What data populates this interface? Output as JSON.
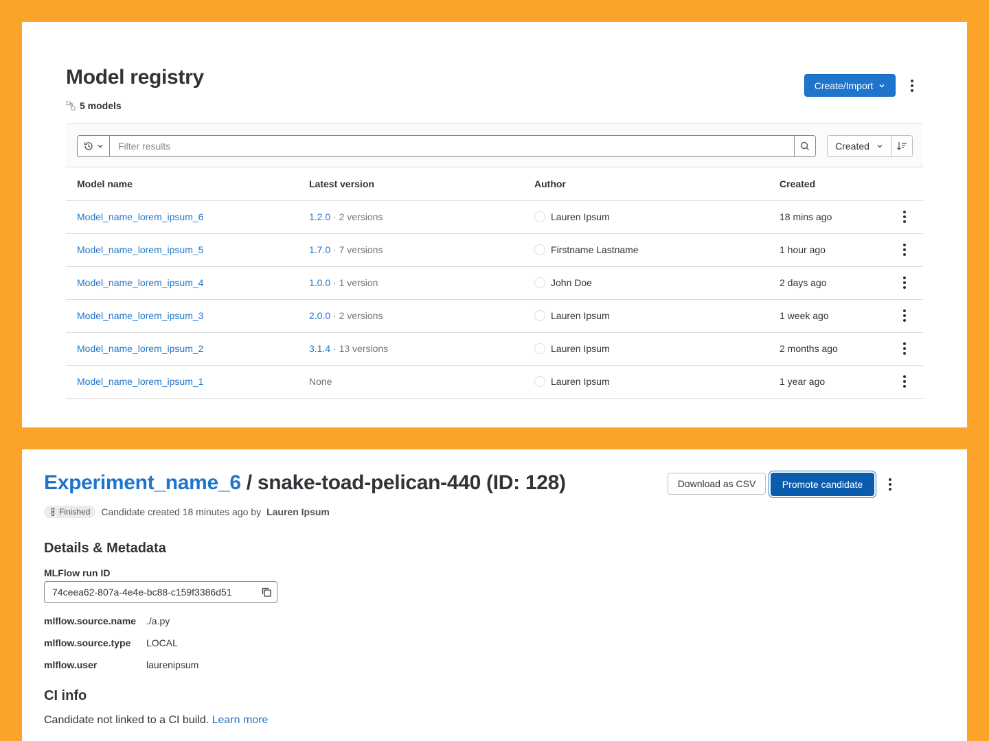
{
  "registry": {
    "title": "Model registry",
    "count_label": "5 models",
    "create_button": "Create/Import",
    "filter_placeholder": "Filter results",
    "sort_label": "Created",
    "columns": [
      "Model name",
      "Latest version",
      "Author",
      "Created"
    ],
    "rows": [
      {
        "name": "Model_name_lorem_ipsum_6",
        "version": "1.2.0",
        "versions": "· 2 versions",
        "author": "Lauren Ipsum",
        "created": "18 mins ago"
      },
      {
        "name": "Model_name_lorem_ipsum_5",
        "version": "1.7.0",
        "versions": "· 7 versions",
        "author": "Firstname Lastname",
        "created": "1 hour ago"
      },
      {
        "name": "Model_name_lorem_ipsum_4",
        "version": "1.0.0",
        "versions": "· 1 version",
        "author": "John Doe",
        "created": "2 days ago"
      },
      {
        "name": "Model_name_lorem_ipsum_3",
        "version": "2.0.0",
        "versions": "· 2 versions",
        "author": "Lauren Ipsum",
        "created": "1 week ago"
      },
      {
        "name": "Model_name_lorem_ipsum_2",
        "version": "3.1.4",
        "versions": "· 13 versions",
        "author": "Lauren Ipsum",
        "created": "2 months ago"
      },
      {
        "name": "Model_name_lorem_ipsum_1",
        "version": "",
        "versions": "None",
        "author": "Lauren Ipsum",
        "created": "1 year ago"
      }
    ]
  },
  "candidate": {
    "experiment_link": "Experiment_name_6",
    "separator": " / ",
    "candidate_name": "snake-toad-pelican-440 (ID: 128)",
    "download_button": "Download as CSV",
    "promote_button": "Promote candidate",
    "status_badge": "Finished",
    "created_text": "Candidate created 18 minutes ago by",
    "created_by": "Lauren Ipsum",
    "details_heading": "Details & Metadata",
    "run_id_label": "MLFlow run ID",
    "run_id": "74ceea62-807a-4e4e-bc88-c159f3386d51",
    "metadata": [
      {
        "key": "mlflow.source.name",
        "value": "./a.py"
      },
      {
        "key": "mlflow.source.type",
        "value": "LOCAL"
      },
      {
        "key": "mlflow.user",
        "value": "laurenipsum"
      }
    ],
    "ci_heading": "CI info",
    "ci_text": "Candidate not linked to a CI build.",
    "ci_link": "Learn more"
  },
  "colors": {
    "background": "#fca429",
    "link": "#1f75cb",
    "primary_button": "#1f75cb",
    "promote_button": "#0b5cad"
  }
}
